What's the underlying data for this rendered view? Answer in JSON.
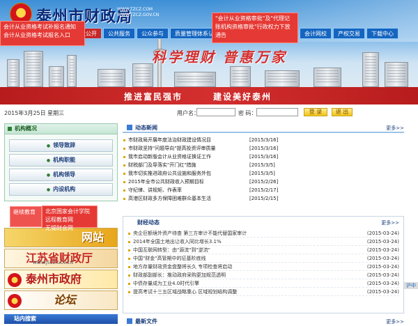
{
  "header": {
    "title": "泰州市财政局",
    "url_line1": "WWW.TZCZ.COM",
    "url_line2": "WWW.TZCZ.GOV.CN",
    "slogan": "科学理财 普惠万家",
    "red_left": "推进富民强市",
    "red_right": "建设美好泰州"
  },
  "nav": [
    "财政公开",
    "公共服务",
    "公众参与",
    "质量管理体系认证",
    "会计网校",
    "产权交易",
    "下载中心"
  ],
  "popups": {
    "left": "会计从业资格考试补报名通知\n会计从业资格考试报名入口",
    "right": "\"会计从业资格审批\"及\"代理记账机构资格审批\"行政权力下放通告",
    "center_red": "北京国家会计学院\n远程教育网\n无锡财会网",
    "center_red2": "继续教育"
  },
  "datebar": {
    "date": "2015年3月25日 星期三",
    "user_label": "用户名：",
    "pass_label": "密 码：",
    "login_btn": "登 录",
    "register_btn": "退 出"
  },
  "left": {
    "org_title": "机构概况",
    "menu": [
      "领导致辞",
      "机构职能",
      "机构领导",
      "内设机构"
    ],
    "ads": {
      "ad1": "网站",
      "ad2": "江苏省财政厅",
      "ad2_sub": "WWW.JSCZ.GOV.CN",
      "ad3": "泰州市政府",
      "ad4": "论坛"
    },
    "search_title": "站内搜索"
  },
  "news": {
    "title": "动态新闻",
    "more": "更多>>",
    "items": [
      {
        "text": "市财政局开展年度法治财政建设情况目",
        "date": "[2015/3/16]"
      },
      {
        "text": "市财政坚持\"问题导向\"提高投资评审质量",
        "date": "[2015/3/16]"
      },
      {
        "text": "我市启动新版会计从业资格证换证工作",
        "date": "[2015/3/16]"
      },
      {
        "text": "财税部门及导落实\"开门红\"措施",
        "date": "[2015/3/5]"
      },
      {
        "text": "我市切实推进政府公共设施和服务外包",
        "date": "[2015/3/5]"
      },
      {
        "text": "2015年全市公共财政收入预期目标",
        "date": "[2015/2/26]"
      },
      {
        "text": "守纪律、讲规矩、作表率",
        "date": "[2015/2/17]"
      },
      {
        "text": "高港区财政多方保障困难群众基本生活",
        "date": "[2015/2/15]"
      }
    ]
  },
  "finance": {
    "title": "财经动态",
    "more": "更多>>",
    "items": [
      {
        "text": "央企巨额境外资产待查 第三方审计不能代替国家审计",
        "date": "(2015-03-24)"
      },
      {
        "text": "2014年全国土地出让收入同比增长3.1%",
        "date": "(2015-03-24)"
      },
      {
        "text": "中国互联网转型：由\"源流\"到\"逆流\"",
        "date": "(2015-03-24)"
      },
      {
        "text": "中国\"财金\"高管期中的征基阶底线",
        "date": "(2015-03-24)"
      },
      {
        "text": "地方存量财政资金盘整将长久 专项检查将启动",
        "date": "(2015-03-24)"
      },
      {
        "text": "财政部副部长：推动政府采购更加规范透明",
        "date": "(2015-03-24)"
      },
      {
        "text": "中债存量成为工业4.0时代引擎",
        "date": "(2015-03-24)"
      },
      {
        "text": "提高考试十三五区域战略重心 区域规划结构调整",
        "date": "(2015-03-24)"
      }
    ]
  },
  "float_tag": "沪中",
  "latest": {
    "title": "最新文件",
    "more": "更多>>"
  },
  "colors": {
    "nav_blue": "#1565c0",
    "red_bar": "#d32f2f",
    "accent_gold": "#f0c419"
  }
}
